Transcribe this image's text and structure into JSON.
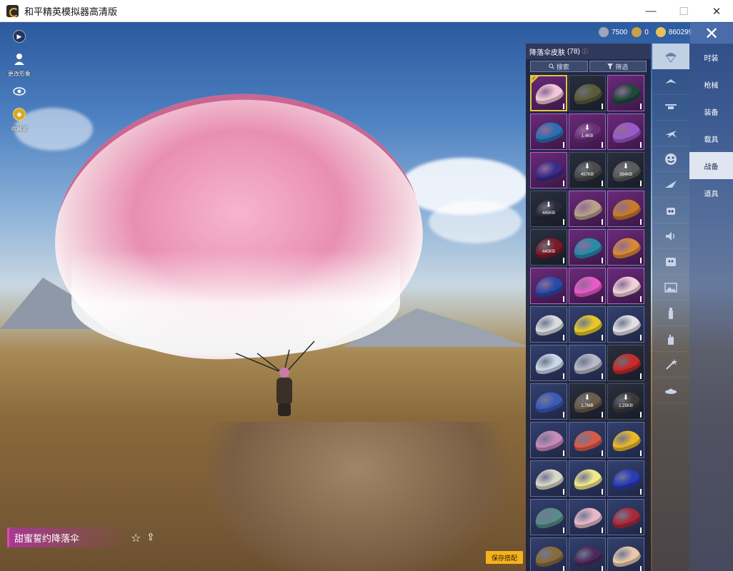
{
  "window": {
    "title": "和平精英模拟器高清版",
    "minimize": "—",
    "maximize": "☐",
    "close": "✕"
  },
  "left_toolbar": {
    "items": [
      {
        "icon": "play-icon",
        "label": ""
      },
      {
        "icon": "person-icon",
        "label": "更改形象"
      },
      {
        "icon": "eye-icon",
        "label": ""
      },
      {
        "icon": "collection-icon",
        "label": "收藏家"
      }
    ]
  },
  "currency": {
    "items": [
      {
        "icon": "coin-icon",
        "value": "7500",
        "color": "#9aa7b8"
      },
      {
        "icon": "medal-icon",
        "value": "0",
        "color": "#c8a04a"
      },
      {
        "icon": "gold-coin-icon",
        "value": "860299",
        "color": "#e8c05a"
      }
    ]
  },
  "panel": {
    "title": "降落伞皮肤",
    "count": "(78)",
    "info_icon": "ⓘ",
    "search_label": "搜索",
    "filter_label": "筛选"
  },
  "skins": [
    {
      "rarity": "legend",
      "color": "#f1c8d6",
      "selected": true,
      "size": "",
      "download": false
    },
    {
      "rarity": "dark",
      "color": "#5a5a3a",
      "selected": false,
      "size": "",
      "download": false
    },
    {
      "rarity": "legend",
      "color": "#1e4a3a",
      "selected": false,
      "size": "",
      "download": false
    },
    {
      "rarity": "legend",
      "color": "#2e6fb0",
      "selected": false,
      "size": "",
      "download": false
    },
    {
      "rarity": "legend",
      "color": "#6a2e7a",
      "selected": false,
      "size": "1.4KB",
      "download": true
    },
    {
      "rarity": "legend",
      "color": "#9a5ac8",
      "selected": false,
      "size": "",
      "download": false
    },
    {
      "rarity": "legend",
      "color": "#3a2a8a",
      "selected": false,
      "size": "",
      "download": false
    },
    {
      "rarity": "dark",
      "color": "#4a4a4a",
      "selected": false,
      "size": "457KB",
      "download": true
    },
    {
      "rarity": "dark",
      "color": "#5a5a5a",
      "selected": false,
      "size": "384KB",
      "download": true
    },
    {
      "rarity": "dark",
      "color": "#2a2a3a",
      "selected": false,
      "size": "445KB",
      "download": true
    },
    {
      "rarity": "legend",
      "color": "#b8a08a",
      "selected": false,
      "size": "",
      "download": false
    },
    {
      "rarity": "legend",
      "color": "#c87a2a",
      "selected": false,
      "size": "",
      "download": false
    },
    {
      "rarity": "dark",
      "color": "#7a1a2a",
      "selected": false,
      "size": "440KB",
      "download": true
    },
    {
      "rarity": "legend",
      "color": "#2a8aa8",
      "selected": false,
      "size": "",
      "download": false
    },
    {
      "rarity": "legend",
      "color": "#d8883a",
      "selected": false,
      "size": "",
      "download": false
    },
    {
      "rarity": "legend",
      "color": "#2a4aa8",
      "selected": false,
      "size": "",
      "download": false
    },
    {
      "rarity": "legend",
      "color": "#e85ac8",
      "selected": false,
      "size": "",
      "download": false
    },
    {
      "rarity": "legend",
      "color": "#f0d0d8",
      "selected": false,
      "size": "",
      "download": false
    },
    {
      "rarity": "rare",
      "color": "#d8dbe0",
      "selected": false,
      "size": "",
      "download": false
    },
    {
      "rarity": "rare",
      "color": "#e8c82a",
      "selected": false,
      "size": "",
      "download": false
    },
    {
      "rarity": "rare",
      "color": "#e0e0e4",
      "selected": false,
      "size": "",
      "download": false
    },
    {
      "rarity": "rare",
      "color": "#c8d8e8",
      "selected": false,
      "size": "",
      "download": false
    },
    {
      "rarity": "rare",
      "color": "#b8b8c8",
      "selected": false,
      "size": "",
      "download": false
    },
    {
      "rarity": "dark",
      "color": "#c82a2a",
      "selected": false,
      "size": "",
      "download": false
    },
    {
      "rarity": "rare",
      "color": "#3a5ab8",
      "selected": false,
      "size": "",
      "download": false
    },
    {
      "rarity": "dark",
      "color": "#6a5a4a",
      "selected": false,
      "size": "1.7MB",
      "download": true
    },
    {
      "rarity": "dark",
      "color": "#3a3a3a",
      "selected": false,
      "size": "1.25KB",
      "download": true
    },
    {
      "rarity": "rare",
      "color": "#c88ab8",
      "selected": false,
      "size": "",
      "download": false
    },
    {
      "rarity": "rare",
      "color": "#d85a4a",
      "selected": false,
      "size": "",
      "download": false
    },
    {
      "rarity": "rare",
      "color": "#e8b82a",
      "selected": false,
      "size": "",
      "download": false
    },
    {
      "rarity": "rare",
      "color": "#d8d8c8",
      "selected": false,
      "size": "",
      "download": false
    },
    {
      "rarity": "rare",
      "color": "#f0e88a",
      "selected": false,
      "size": "",
      "download": false
    },
    {
      "rarity": "rare",
      "color": "#2a3ab8",
      "selected": false,
      "size": "",
      "download": false
    },
    {
      "rarity": "rare",
      "color": "#5a8a8a",
      "selected": false,
      "size": "",
      "download": false
    },
    {
      "rarity": "rare",
      "color": "#e8b8c8",
      "selected": false,
      "size": "",
      "download": false
    },
    {
      "rarity": "rare",
      "color": "#a82a3a",
      "selected": false,
      "size": "",
      "download": false
    },
    {
      "rarity": "rare",
      "color": "#8a6a3a",
      "selected": false,
      "size": "",
      "download": false
    },
    {
      "rarity": "rare",
      "color": "#4a2a5a",
      "selected": false,
      "size": "",
      "download": false
    },
    {
      "rarity": "rare",
      "color": "#e8c8a8",
      "selected": false,
      "size": "",
      "download": false
    }
  ],
  "icon_column": [
    {
      "icon": "parachute-icon",
      "active": true
    },
    {
      "icon": "glider-icon",
      "active": false
    },
    {
      "icon": "drone-icon",
      "active": false
    },
    {
      "icon": "plane-icon",
      "active": false
    },
    {
      "icon": "emote-icon",
      "active": false
    },
    {
      "icon": "trail-icon",
      "active": false
    },
    {
      "icon": "robot-icon",
      "active": false
    },
    {
      "icon": "sound-icon",
      "active": false
    },
    {
      "icon": "sticker-icon",
      "active": false
    },
    {
      "icon": "photo-icon",
      "active": false
    },
    {
      "icon": "spray-icon",
      "active": false
    },
    {
      "icon": "hand-icon",
      "active": false
    },
    {
      "icon": "magic-icon",
      "active": false
    },
    {
      "icon": "ufo-icon",
      "active": false
    }
  ],
  "categories": [
    {
      "label": "时装",
      "active": false
    },
    {
      "label": "枪械",
      "active": false
    },
    {
      "label": "装备",
      "active": false
    },
    {
      "label": "载具",
      "active": false
    },
    {
      "label": "战备",
      "active": true
    },
    {
      "label": "道具",
      "active": false
    }
  ],
  "bottom": {
    "skin_name": "甜蜜誓约降落伞",
    "save_label": "保存搭配",
    "fav_icon": "☆",
    "share_icon": "⇪"
  }
}
